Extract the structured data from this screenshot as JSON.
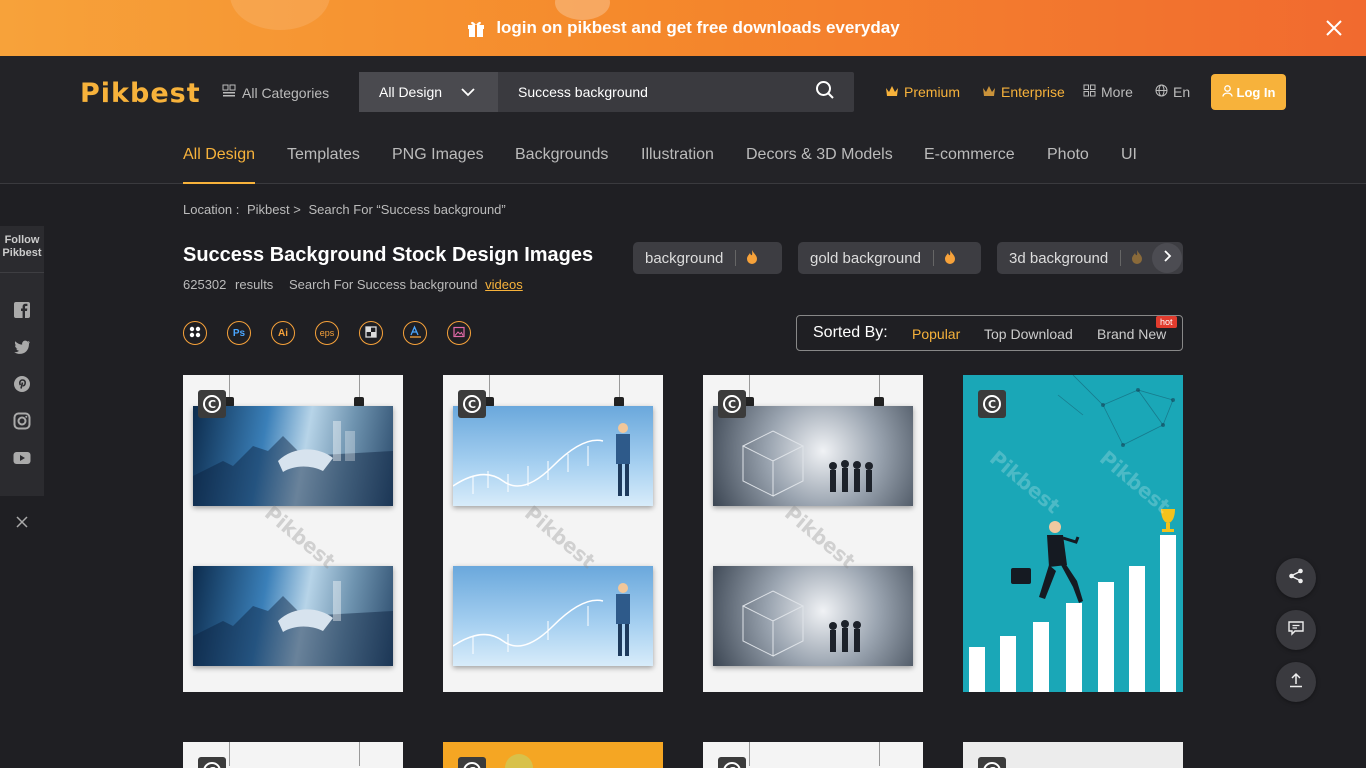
{
  "promo": {
    "text": "login on pikbest and get free downloads everyday"
  },
  "header": {
    "logo": "Pikbest",
    "all_categories": "All Categories",
    "search_type": "All Design",
    "search_value": "Success background",
    "premium": "Premium",
    "enterprise": "Enterprise",
    "more": "More",
    "language": "En",
    "login": "Log In"
  },
  "tabs": [
    "All Design",
    "Templates",
    "PNG Images",
    "Backgrounds",
    "Illustration",
    "Decors & 3D Models",
    "E-commerce",
    "Photo",
    "UI"
  ],
  "follow": {
    "title_line1": "Follow",
    "title_line2": "Pikbest"
  },
  "breadcrumb": {
    "location": "Location :",
    "site": "Pikbest >",
    "search_label": "Search  For",
    "query": "“Success background”"
  },
  "page_title": "Success Background Stock Design Images",
  "results": {
    "count": "625302",
    "label": "results",
    "search_text": "Search  For  Success background",
    "videos_link": "videos"
  },
  "chips": [
    "background",
    "gold background",
    "3d background"
  ],
  "file_types": [
    "all",
    "Ps",
    "Ai",
    "eps",
    "sketch",
    "ae",
    "image"
  ],
  "sort": {
    "label": "Sorted By:",
    "options": [
      "Popular",
      "Top Download",
      "Brand New"
    ],
    "hot_badge": "hot"
  },
  "watermark": "Pikbest",
  "colors": {
    "accent": "#f7b23b",
    "bg": "#1f1f23",
    "header": "#232327"
  }
}
